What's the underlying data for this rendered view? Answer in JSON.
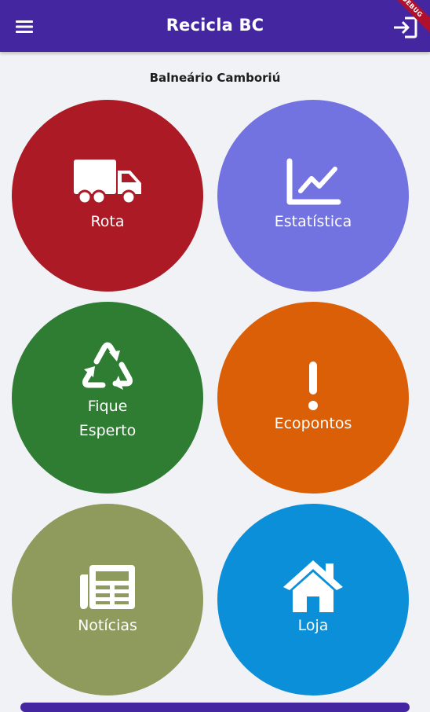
{
  "appbar": {
    "title": "Recicla BC",
    "menu_icon": "menu-icon",
    "login_icon": "login-icon",
    "debug_banner": "DEBUG",
    "color": "#4426a0"
  },
  "city": "Balneário Camboriú",
  "tiles": [
    {
      "label": "Rota",
      "icon": "truck-icon",
      "color": "#ab1a25"
    },
    {
      "label": "Estatística",
      "icon": "chart-line-icon",
      "color": "#7272e0"
    },
    {
      "label": "Fique\nEsperto",
      "icon": "recycle-icon",
      "color": "#2e7d32"
    },
    {
      "label": "Ecopontos",
      "icon": "exclamation-icon",
      "color": "#db5f06"
    },
    {
      "label": "Notícias",
      "icon": "newspaper-icon",
      "color": "#8e9b5c"
    },
    {
      "label": "Loja",
      "icon": "home-icon",
      "color": "#0a8fd8"
    }
  ],
  "background": "#f0f2f6"
}
